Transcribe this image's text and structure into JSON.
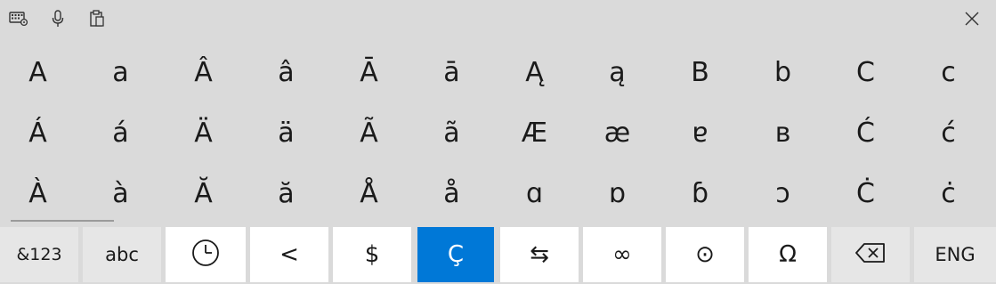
{
  "toolbar": {
    "icons": [
      "keyboard-settings-icon",
      "microphone-icon",
      "clipboard-icon"
    ],
    "close_icon": "close-icon"
  },
  "characters": [
    [
      "A",
      "a",
      "Â",
      "â",
      "Ā",
      "ā",
      "Ą",
      "ą",
      "B",
      "b",
      "C",
      "c"
    ],
    [
      "Á",
      "á",
      "Ä",
      "ä",
      "Ã",
      "ã",
      "Æ",
      "æ",
      "ɐ",
      "ʙ",
      "Ć",
      "ć"
    ],
    [
      "À",
      "à",
      "Ă",
      "ă",
      "Å",
      "å",
      "ɑ",
      "ɒ",
      "ɓ",
      "ɔ",
      "Ċ",
      "ċ"
    ]
  ],
  "keys": {
    "num": "&123",
    "abc": "abc",
    "recent_icon": "clock-icon",
    "less_than": "<",
    "dollar": "$",
    "cedilla": "Ç",
    "arrows": "⇆",
    "infinity": "∞",
    "circle_dot": "⊙",
    "omega": "Ω",
    "backspace_icon": "backspace-icon",
    "lang": "ENG"
  },
  "colors": {
    "panel_bg": "#dadada",
    "key_light": "#ffffff",
    "key_dark": "#e6e6e6",
    "accent": "#0078d7"
  }
}
